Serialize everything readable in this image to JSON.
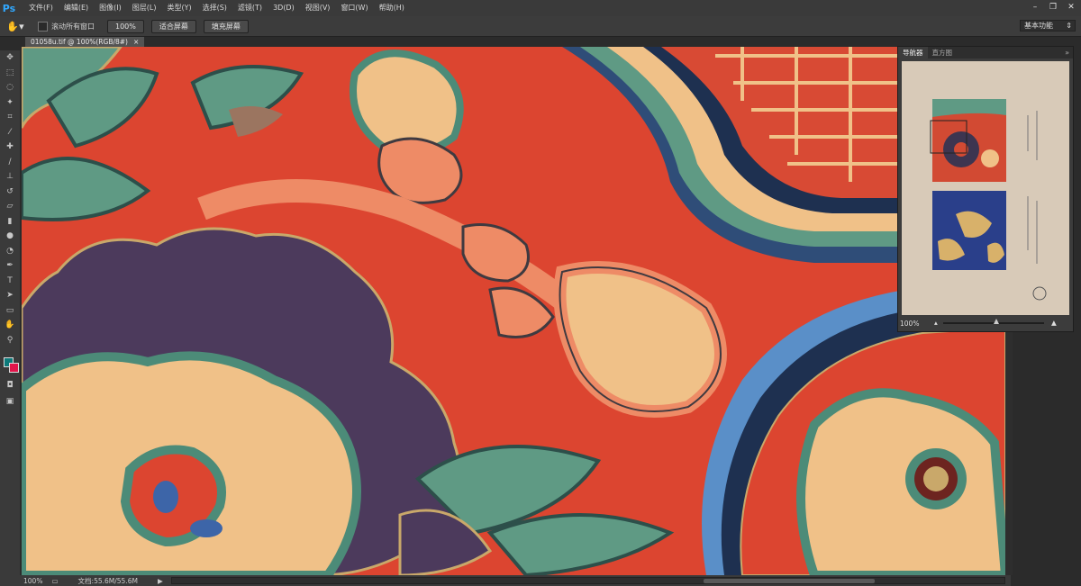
{
  "app": {
    "logo": "Ps"
  },
  "menu": [
    "文件(F)",
    "编辑(E)",
    "图像(I)",
    "图层(L)",
    "类型(Y)",
    "选择(S)",
    "滤镜(T)",
    "3D(D)",
    "视图(V)",
    "窗口(W)",
    "帮助(H)"
  ],
  "window_buttons": [
    "–",
    "❐",
    "✕"
  ],
  "options": {
    "scroll_all_label": "滚动所有窗口",
    "btn_100": "100%",
    "btn_fit": "适合屏幕",
    "btn_fill": "填充屏幕",
    "workspace": "基本功能"
  },
  "document": {
    "tab_title": "01058u.tif @ 100%(RGB/8#)",
    "tab_close": "×"
  },
  "status": {
    "zoom": "100%",
    "doc_size": "文档:55.6M/55.6M",
    "arrow": "▶"
  },
  "navigator": {
    "tab_navigator": "导航器",
    "tab_histogram": "直方图",
    "zoom": "100%",
    "close": "»"
  },
  "colors": {
    "foreground": "#0d7a7a",
    "background": "#e2154b",
    "accent": "#31a8ff"
  },
  "tools": [
    "move-icon",
    "marquee-icon",
    "lasso-icon",
    "magic-wand-icon",
    "crop-icon",
    "eyedropper-icon",
    "healing-brush-icon",
    "brush-icon",
    "clone-stamp-icon",
    "history-brush-icon",
    "eraser-icon",
    "gradient-icon",
    "blur-icon",
    "dodge-icon",
    "pen-icon",
    "type-icon",
    "path-selection-icon",
    "rectangle-icon",
    "hand-icon",
    "zoom-icon"
  ]
}
